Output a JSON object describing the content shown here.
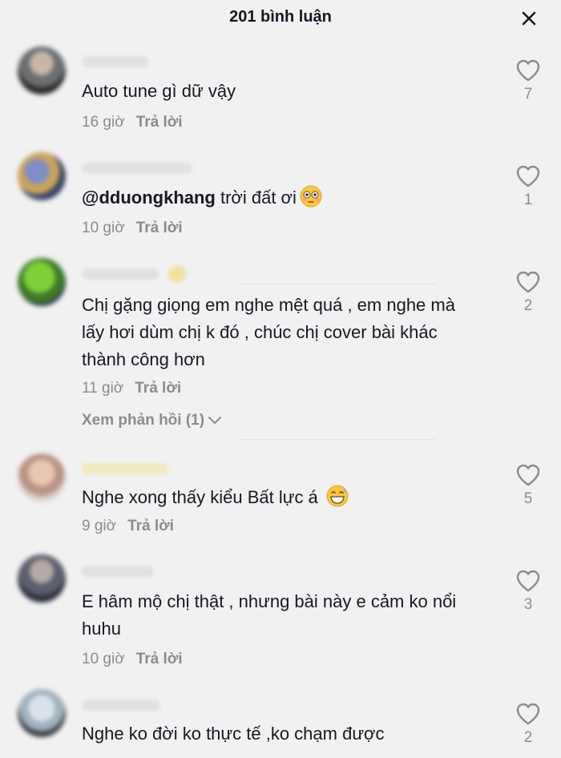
{
  "header": {
    "title": "201 bình luận",
    "close_icon": "close-icon"
  },
  "labels": {
    "reply": "Trả lời"
  },
  "comments": [
    {
      "text": "Auto tune gì dữ vậy",
      "time": "16 giờ",
      "likes": "7"
    },
    {
      "mention": "@dduongkhang",
      "text": " trời đất ơi",
      "emoji": "flushed-face-emoji",
      "time": "10 giờ",
      "likes": "1"
    },
    {
      "text": "Chị gặng giọng em nghe mệt quá , em nghe mà lấy hơi dùm chị k đó , chúc chị cover bài khác thành công hơn",
      "time": "11 giờ",
      "likes": "2",
      "view_replies": "Xem phản hồi (1)"
    },
    {
      "text": "Nghe xong thấy kiểu Bất lực á",
      "emoji": "grinning-sweat-emoji",
      "time": "9 giờ",
      "likes": "5"
    },
    {
      "text": "E hâm mộ chị thật , nhưng bài này e cảm ko nổi huhu",
      "time": "10 giờ",
      "likes": "3"
    },
    {
      "text": "Nghe ko đời ko thực tế ,ko chạm được",
      "likes": "2"
    }
  ],
  "colors": {
    "background": "#f1f1f2",
    "text": "#161823",
    "muted": "#8a8b91"
  }
}
